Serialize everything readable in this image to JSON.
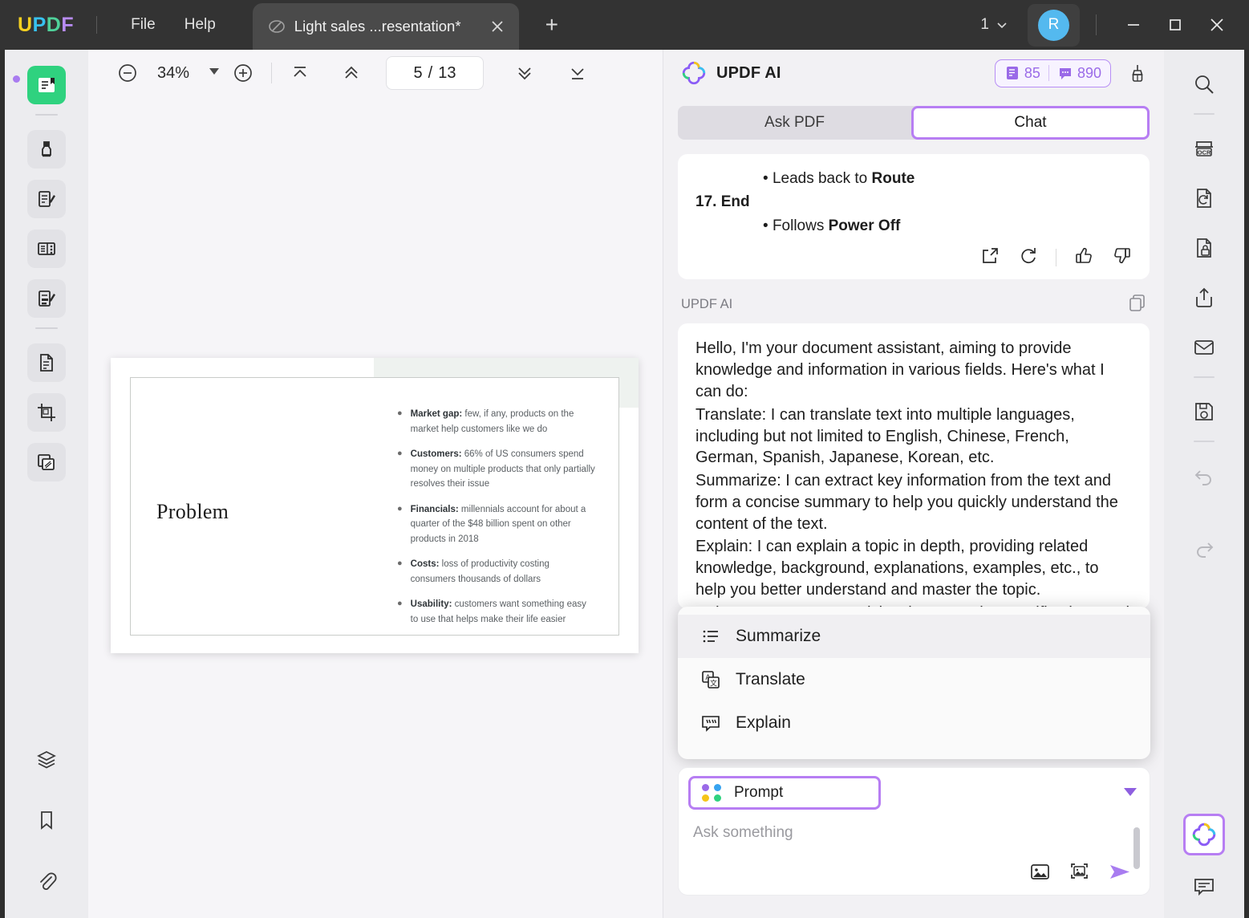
{
  "titlebar": {
    "brand": "UPDF",
    "brand_letters": [
      "U",
      "P",
      "D",
      "F"
    ],
    "menus": [
      "File",
      "Help"
    ],
    "tab": {
      "title": "Light sales ...resentation*",
      "favicon": "document-slash-icon",
      "close": "close-icon"
    },
    "new_tab": "+",
    "account_count": "1",
    "account_caret": "chevron-down-icon",
    "avatar_initial": "R",
    "window_controls": {
      "minimize": "minimize-icon",
      "maximize": "maximize-icon",
      "close": "close-icon"
    }
  },
  "left_rail": {
    "items": [
      {
        "name": "reader-icon",
        "label": "Reader",
        "active": true
      },
      {
        "name": "highlighter-icon",
        "label": "Annotate",
        "active": false
      },
      {
        "name": "edit-pdf-icon",
        "label": "Edit PDF",
        "active": false
      },
      {
        "name": "page-organize-icon",
        "label": "Organize Pages",
        "active": false
      },
      {
        "name": "form-icon",
        "label": "Form",
        "active": false
      },
      {
        "name": "convert-icon",
        "label": "Convert PDF",
        "active": false
      },
      {
        "name": "crop-icon",
        "label": "Crop",
        "active": false
      },
      {
        "name": "compare-icon",
        "label": "Compare",
        "active": false
      }
    ],
    "bottom_items": [
      {
        "name": "layers-icon",
        "label": "Layers"
      },
      {
        "name": "bookmark-icon",
        "label": "Bookmark"
      },
      {
        "name": "attachment-icon",
        "label": "Attachment"
      }
    ]
  },
  "toolbar": {
    "zoom_out": "zoom-out-icon",
    "zoom_value": "34%",
    "zoom_caret": "chevron-down-icon",
    "zoom_in": "zoom-in-icon",
    "first_page": "first-page-icon",
    "prev_page": "previous-page-icon",
    "current_page": "5",
    "page_divider": "/",
    "total_pages": "13",
    "next_page": "next-page-icon",
    "last_page": "last-page-icon"
  },
  "document": {
    "slide_title": "Problem",
    "bullets": [
      {
        "lead": "Market gap:",
        "text": " few, if any, products on the market help customers like we do"
      },
      {
        "lead": "Customers:",
        "text": " 66% of US consumers spend money on multiple products that only partially resolves their issue"
      },
      {
        "lead": "Financials:",
        "text": " millennials account for about a quarter of the $48 billion spent on other products in 2018"
      },
      {
        "lead": "Costs:",
        "text": " loss of productivity costing consumers thousands of dollars"
      },
      {
        "lead": "Usability:",
        "text": " customers want something easy to use that helps make their life easier"
      }
    ]
  },
  "ai_panel": {
    "logo": "updf-ai-logo-icon",
    "title": "UPDF AI",
    "credits": {
      "pages_icon": "pages-credit-icon",
      "pages": "85",
      "chat_icon": "chat-credit-icon",
      "chats": "890"
    },
    "clear_icon": "broom-icon",
    "tabs": [
      {
        "label": "Ask PDF",
        "active": false
      },
      {
        "label": "Chat",
        "active": true
      }
    ],
    "previous_message": {
      "bullet_one": "Leads back to ",
      "bullet_one_bold": "Route",
      "heading": "17. End",
      "bullet_two": "Follows ",
      "bullet_two_bold": "Power Off",
      "actions": [
        {
          "name": "open-external-icon"
        },
        {
          "name": "regenerate-icon"
        },
        {
          "name": "thumbs-up-icon"
        },
        {
          "name": "thumbs-down-icon"
        }
      ]
    },
    "response_label": "UPDF AI",
    "copy_icon": "copy-icon",
    "response_paragraphs": [
      "Hello, I'm your document assistant, aiming to provide knowledge and information in various fields. Here's what I can do:",
      "Translate: I can translate text into multiple languages, including but not limited to English, Chinese, French, German, Spanish, Japanese, Korean, etc.",
      "Summarize: I can extract key information from the text and form a concise summary to help you quickly understand the content of the text.",
      "Explain: I can explain a topic in depth, providing related knowledge, background, explanations, examples, etc., to help you better understand and master the topic.",
      "Write: I can generate articles that meet the specifications and"
    ],
    "dropdown": {
      "items": [
        {
          "label": "Summarize",
          "icon": "list-icon",
          "highlighted": true
        },
        {
          "label": "Translate",
          "icon": "translate-icon",
          "highlighted": false
        },
        {
          "label": "Explain",
          "icon": "explain-chat-icon",
          "highlighted": false
        }
      ]
    },
    "prompt": {
      "pill_label": "Prompt",
      "pill_icon": "four-dots-icon",
      "caret": "caret-down-icon",
      "placeholder": "Ask something",
      "input_value": "",
      "actions": [
        {
          "name": "insert-image-icon"
        },
        {
          "name": "screenshot-icon"
        },
        {
          "name": "send-icon"
        }
      ]
    }
  },
  "right_rail": {
    "items": [
      {
        "name": "search-icon",
        "label": "Search"
      },
      {
        "name": "ocr-icon",
        "label": "OCR"
      },
      {
        "name": "convert-file-icon",
        "label": "Convert"
      },
      {
        "name": "protect-icon",
        "label": "Protect"
      },
      {
        "name": "share-icon",
        "label": "Share"
      },
      {
        "name": "email-icon",
        "label": "Email"
      },
      {
        "name": "save-icon",
        "label": "Save"
      },
      {
        "name": "undo-icon",
        "label": "Undo"
      },
      {
        "name": "redo-icon",
        "label": "Redo"
      }
    ],
    "ai_button": {
      "name": "updf-ai-button",
      "active": true
    },
    "comment_button": {
      "name": "comment-icon"
    }
  },
  "colors": {
    "accent_purple": "#b77ef3",
    "accent_green": "#2fd27f",
    "avatar_blue": "#54b9ef",
    "titlebar": "#333333",
    "panel_bg": "#f2f1f4",
    "rail_bg": "#ececef"
  }
}
